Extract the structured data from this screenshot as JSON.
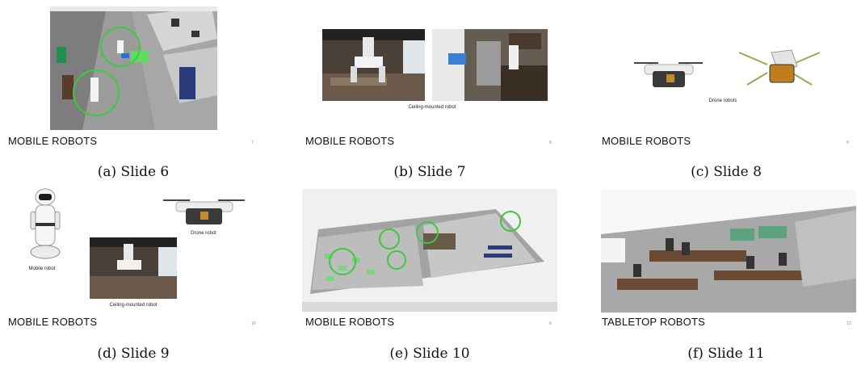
{
  "slides": [
    {
      "title": "MOBILE ROBOTS",
      "page": "7",
      "caption": "(a) Slide 6"
    },
    {
      "title": "MOBILE ROBOTS",
      "page": "8",
      "caption": "(b) Slide 7",
      "image_label": "Ceiling-mounted robot"
    },
    {
      "title": "MOBILE ROBOTS",
      "page": "9",
      "caption": "(c) Slide 8",
      "image_label": "Drone robots"
    },
    {
      "title": "MOBILE ROBOTS",
      "page": "10",
      "caption": "(d) Slide 9",
      "labels": {
        "mobile": "Mobile robot",
        "drone": "Drone robot",
        "ceiling": "Ceiling-mounted robot"
      }
    },
    {
      "title": "MOBILE ROBOTS",
      "page": "6",
      "caption": "(e) Slide 10"
    },
    {
      "title": "TABLETOP ROBOTS",
      "page": "12",
      "caption": "(f) Slide 11"
    }
  ],
  "colors": {
    "highlight_circle": "#3ec93e",
    "floor": "#9a9a9a",
    "wall": "#f2f2f2"
  }
}
